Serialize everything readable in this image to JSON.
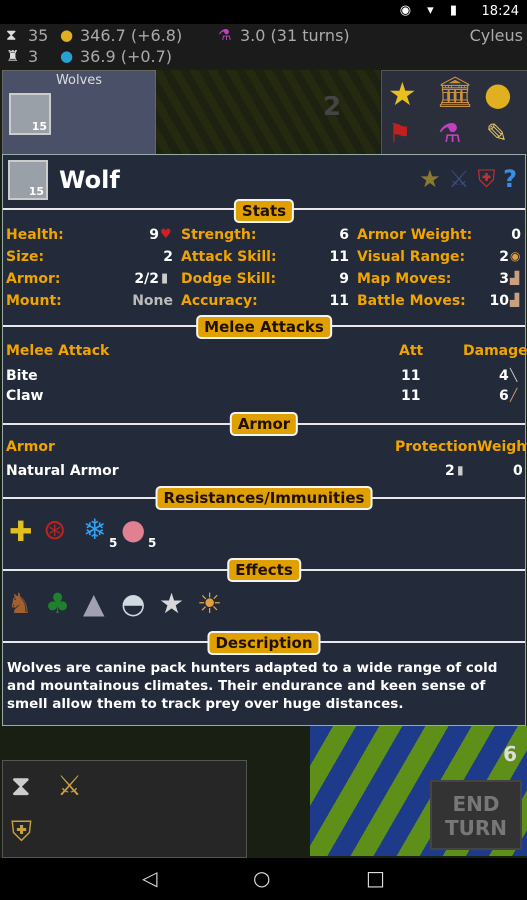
{
  "status_bar": {
    "time": "18:24"
  },
  "top_bar": {
    "turn": "35",
    "gold": "346.7 (+6.8)",
    "potion": "3.0 (31 turns)",
    "player": "Cyleus",
    "units": "3",
    "mana": "36.9 (+0.7)"
  },
  "left_panel": {
    "title": "Wolves",
    "level": "15"
  },
  "hex_number": "2",
  "unit": {
    "name": "Wolf",
    "level": "15"
  },
  "sections": {
    "stats": "Stats",
    "melee": "Melee Attacks",
    "armor": "Armor",
    "resist": "Resistances/Immunities",
    "effects": "Effects",
    "description": "Description"
  },
  "stats": {
    "health_label": "Health:",
    "health": "9",
    "size_label": "Size:",
    "size": "2",
    "armor_label": "Armor:",
    "armor": "2/2",
    "mount_label": "Mount:",
    "mount": "None",
    "strength_label": "Strength:",
    "strength": "6",
    "attack_label": "Attack Skill:",
    "attack": "11",
    "dodge_label": "Dodge Skill:",
    "dodge": "9",
    "accuracy_label": "Accuracy:",
    "accuracy": "11",
    "armor_weight_label": "Armor Weight:",
    "armor_weight": "0",
    "visual_label": "Visual Range:",
    "visual": "2",
    "map_label": "Map Moves:",
    "map": "3",
    "battle_label": "Battle Moves:",
    "battle": "10"
  },
  "melee": {
    "headers": {
      "name": "Melee Attack",
      "att": "Att",
      "damage": "Damage"
    },
    "rows": [
      {
        "name": "Bite",
        "att": "11",
        "damage": "4"
      },
      {
        "name": "Claw",
        "att": "11",
        "damage": "6"
      }
    ]
  },
  "armor": {
    "headers": {
      "name": "Armor",
      "prot": "Protection",
      "weight": "Weight"
    },
    "rows": [
      {
        "name": "Natural Armor",
        "prot": "2",
        "weight": "0"
      }
    ]
  },
  "resistances": {
    "cold": "5",
    "mind": "5"
  },
  "description": "Wolves are canine pack hunters adapted to a wide range of cold and mountainous climates. Their endurance and keen sense of smell allow them to track prey over huge distances.",
  "corner_number": "6",
  "end_turn": {
    "line1": "END",
    "line2": "TURN"
  },
  "colors": {
    "accent": "#f0a400",
    "dialog_bg": "#232a3a",
    "label_bg": "#e0a000"
  }
}
